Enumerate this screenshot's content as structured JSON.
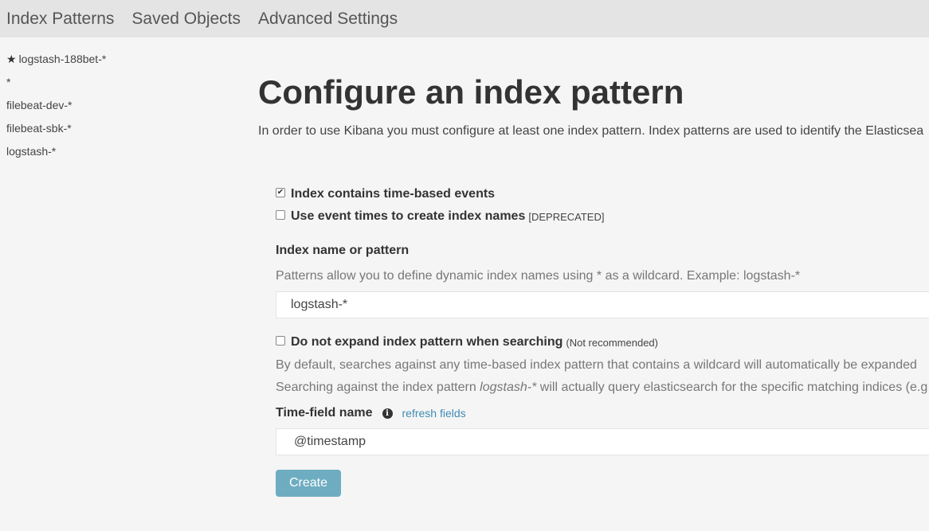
{
  "topnav": {
    "tabs": [
      {
        "label": "Index Patterns"
      },
      {
        "label": "Saved Objects"
      },
      {
        "label": "Advanced Settings"
      }
    ]
  },
  "sidebar": {
    "items": [
      {
        "label": "logstash-188bet-*",
        "default": true
      },
      {
        "label": "*"
      },
      {
        "label": "filebeat-dev-*"
      },
      {
        "label": "filebeat-sbk-*"
      },
      {
        "label": "logstash-*"
      }
    ]
  },
  "main": {
    "title": "Configure an index pattern",
    "intro": "In order to use Kibana you must configure at least one index pattern. Index patterns are used to identify the Elasticsea"
  },
  "form": {
    "time_based": {
      "label": "Index contains time-based events",
      "checked": "✔"
    },
    "event_times": {
      "label": "Use event times to create index names",
      "note": "[DEPRECATED]"
    },
    "index_name_label": "Index name or pattern",
    "index_name_help": "Patterns allow you to define dynamic index names using * as a wildcard. Example: logstash-*",
    "index_name_value": "logstash-*",
    "no_expand": {
      "label": "Do not expand index pattern when searching",
      "note": "(Not recommended)"
    },
    "expand_help_1": "By default, searches against any time-based index pattern that contains a wildcard will automatically be expanded",
    "expand_help_2_prefix": "Searching against the index pattern ",
    "expand_help_2_pattern": "logstash-*",
    "expand_help_2_suffix": " will actually query elasticsearch for the specific matching indices (e.g",
    "time_field_label": "Time-field name",
    "refresh_fields": "refresh fields",
    "time_field_value": "@timestamp",
    "create_label": "Create",
    "info_icon_glyph": "i",
    "star_glyph": "★"
  }
}
